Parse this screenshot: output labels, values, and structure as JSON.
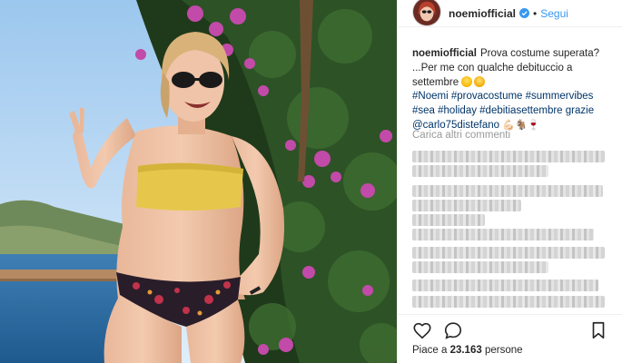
{
  "post": {
    "username": "noemiofficial",
    "follow_label": "Segui",
    "separator": "•"
  },
  "caption": {
    "username": "noemiofficial",
    "line1": "Prova costume superata?",
    "line2": "...Per me con qualche debituccio a",
    "line3": "settembre",
    "line4": "#Noemi #provacostume #summervibes",
    "line5": "#sea #holiday #debitiasettembre grazie",
    "mention": "@carlo75distefano",
    "line6_glyphs": "💪🏻🐐🍷"
  },
  "comments": {
    "load_more_label": "Carica altri commenti"
  },
  "actions": {
    "likes_prefix": "Piace a",
    "likes_count": "23.163",
    "likes_suffix": "persone"
  },
  "icons": {
    "heart": "heart-icon",
    "comment": "comment-bubble-icon",
    "bookmark": "bookmark-icon",
    "verified": "verified-badge-icon"
  },
  "colors": {
    "link_blue": "#3897f0",
    "verified_blue": "#3897f0",
    "muted_text": "#999999"
  }
}
